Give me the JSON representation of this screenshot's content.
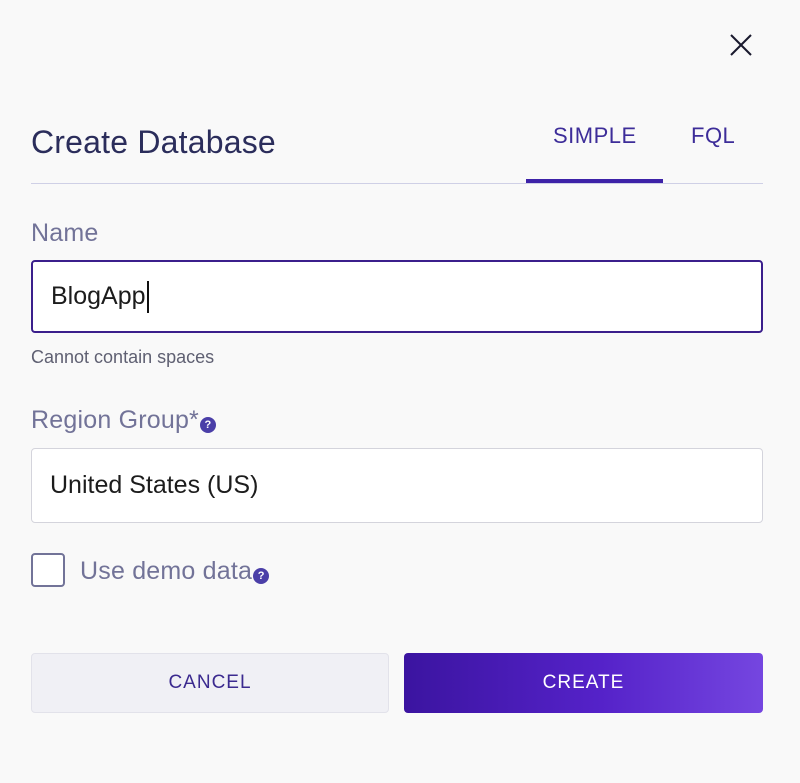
{
  "dialog": {
    "title": "Create Database",
    "tabs": [
      {
        "label": "SIMPLE",
        "active": true
      },
      {
        "label": "FQL",
        "active": false
      }
    ],
    "close_icon": "close-icon"
  },
  "form": {
    "name": {
      "label": "Name",
      "value": "BlogApp",
      "hint": "Cannot contain spaces"
    },
    "region": {
      "label": "Region Group*",
      "value": "United States (US)",
      "help_icon": "question-circle-icon"
    },
    "demo_data": {
      "label": "Use demo data",
      "checked": false,
      "help_icon": "question-circle-icon"
    }
  },
  "actions": {
    "cancel_label": "CANCEL",
    "create_label": "CREATE"
  },
  "colors": {
    "accent": "#3d22a8",
    "title": "#2b2d5b",
    "label": "#727398",
    "create_gradient_start": "#3b14a0",
    "create_gradient_end": "#7546e0"
  }
}
